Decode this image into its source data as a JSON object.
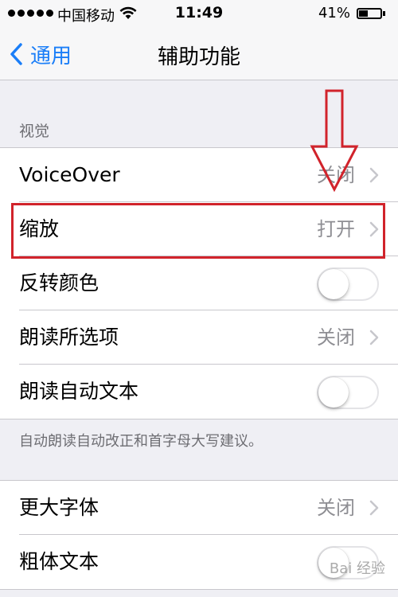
{
  "status_bar": {
    "carrier": "中国移动",
    "time": "11:49",
    "battery_percent": "41%",
    "battery_level": 0.41,
    "wifi_icon": "wifi-icon",
    "signal_icon": "signal-dots-icon"
  },
  "nav": {
    "back_label": "通用",
    "title": "辅助功能",
    "back_icon": "chevron-left-icon"
  },
  "vision_section": {
    "header": "视觉",
    "rows": [
      {
        "label": "VoiceOver",
        "value": "关闭",
        "type": "disclosure"
      },
      {
        "label": "缩放",
        "value": "打开",
        "type": "disclosure"
      },
      {
        "label": "反转颜色",
        "type": "toggle",
        "on": false
      },
      {
        "label": "朗读所选项",
        "value": "关闭",
        "type": "disclosure"
      },
      {
        "label": "朗读自动文本",
        "type": "toggle",
        "on": false
      }
    ],
    "footer": "自动朗读自动改正和首字母大写建议。"
  },
  "text_section": {
    "rows": [
      {
        "label": "更大字体",
        "value": "关闭",
        "type": "disclosure"
      },
      {
        "label": "粗体文本",
        "type": "toggle",
        "on": false
      }
    ]
  },
  "annotation": {
    "highlight_color": "#d1232b",
    "arrow_icon": "down-arrow-icon"
  },
  "watermark": "Bai 经验",
  "colors": {
    "accent": "#1a7ef8",
    "background": "#efeff4",
    "secondary_text": "#8e8e93"
  }
}
